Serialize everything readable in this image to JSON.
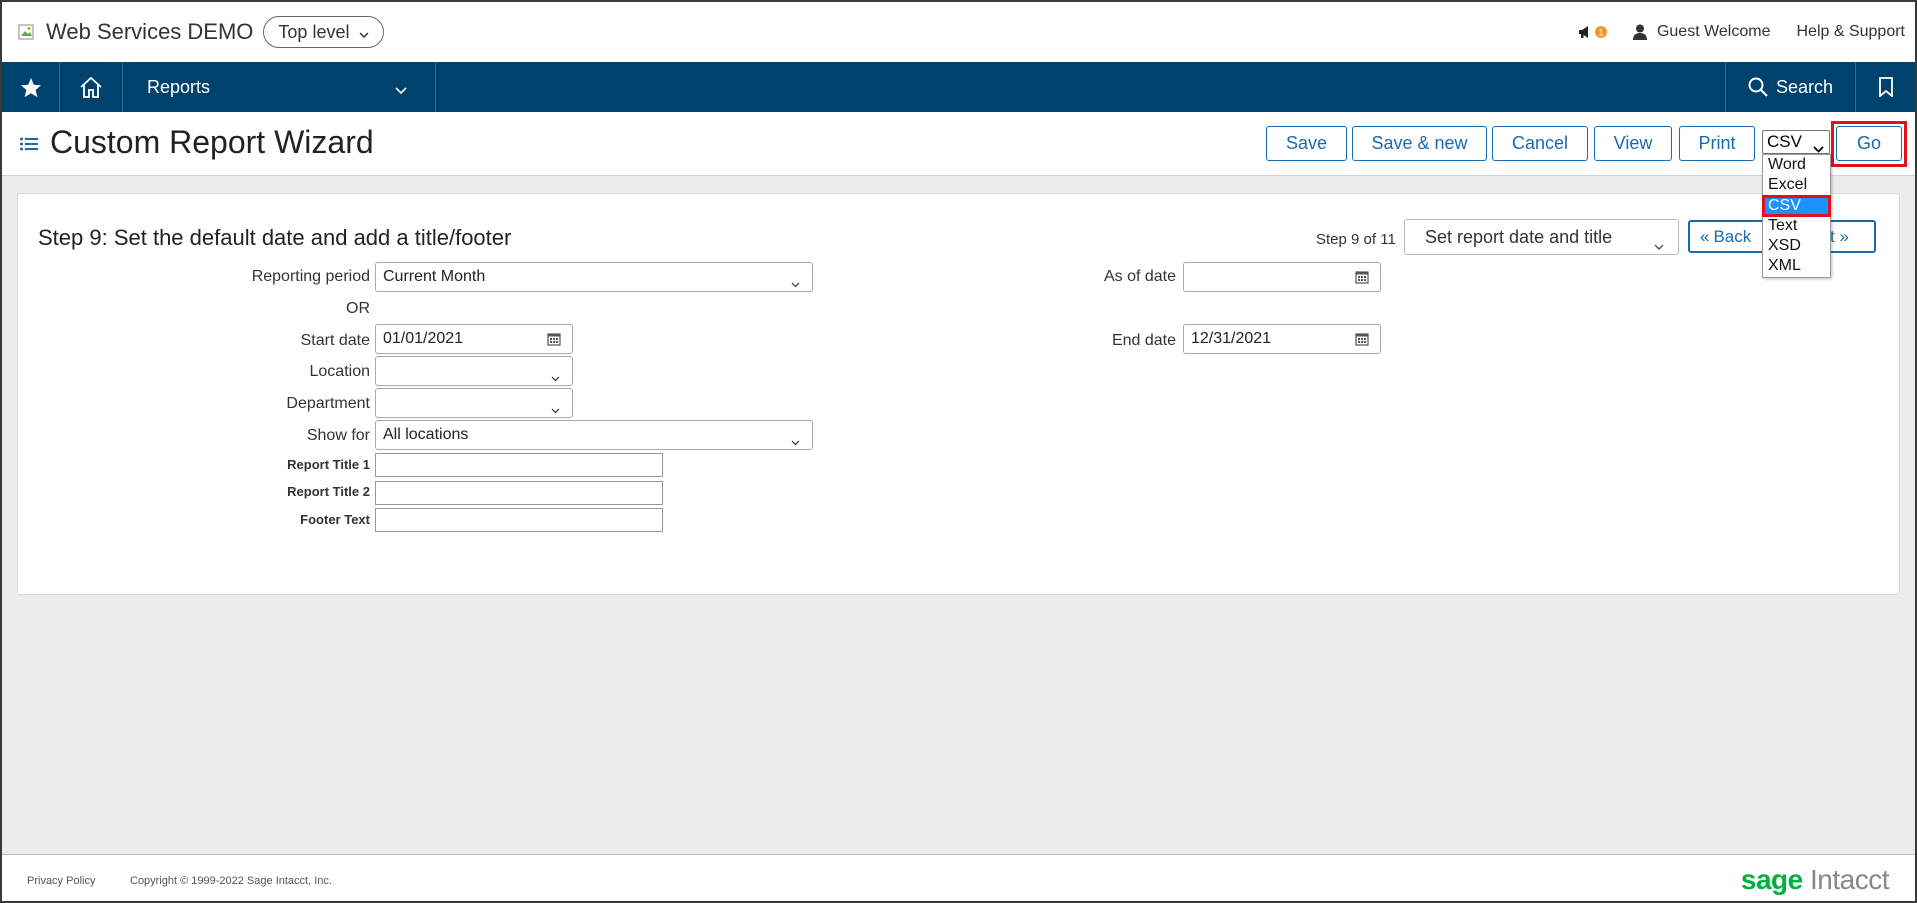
{
  "header": {
    "company": "Web Services DEMO",
    "level": "Top level",
    "notification_count": "1",
    "user": "Guest Welcome",
    "help": "Help & Support"
  },
  "nav": {
    "module": "Reports",
    "search": "Search",
    "icons": [
      "star-icon",
      "home-icon",
      "search-icon",
      "bookmark-icon"
    ],
    "bg_color": "#00426e"
  },
  "titlebar": {
    "title": "Custom Report Wizard",
    "buttons": {
      "save": "Save",
      "save_new": "Save & new",
      "cancel": "Cancel",
      "view": "View",
      "print": "Print",
      "go": "Go"
    },
    "format_selected": "CSV",
    "format_options": [
      "Word",
      "Excel",
      "CSV",
      "Text",
      "XSD",
      "XML"
    ]
  },
  "wizard": {
    "step_title": "Step 9: Set the default date and add a title/footer",
    "step_count": "Step 9 of 11",
    "step_select": "Set report date and title",
    "back": "Back",
    "next": "t",
    "fields": {
      "reporting_period_label": "Reporting period",
      "reporting_period_value": "Current Month",
      "or_label": "OR",
      "start_date_label": "Start date",
      "start_date_value": "01/01/2021",
      "as_of_date_label": "As of date",
      "as_of_date_value": "",
      "end_date_label": "End date",
      "end_date_value": "12/31/2021",
      "location_label": "Location",
      "location_value": "",
      "department_label": "Department",
      "department_value": "",
      "show_for_label": "Show for",
      "show_for_value": "All locations",
      "report_title1_label": "Report Title 1",
      "report_title2_label": "Report Title 2",
      "footer_text_label": "Footer Text"
    }
  },
  "footer": {
    "privacy": "Privacy Policy",
    "copyright": "Copyright © 1999-2022 Sage Intacct, Inc.",
    "brand_sage": "sage",
    "brand_intacct": "Intacct"
  },
  "colors": {
    "accent": "#1a6aae",
    "highlight": "#e4101c",
    "brand_green": "#00b140"
  }
}
